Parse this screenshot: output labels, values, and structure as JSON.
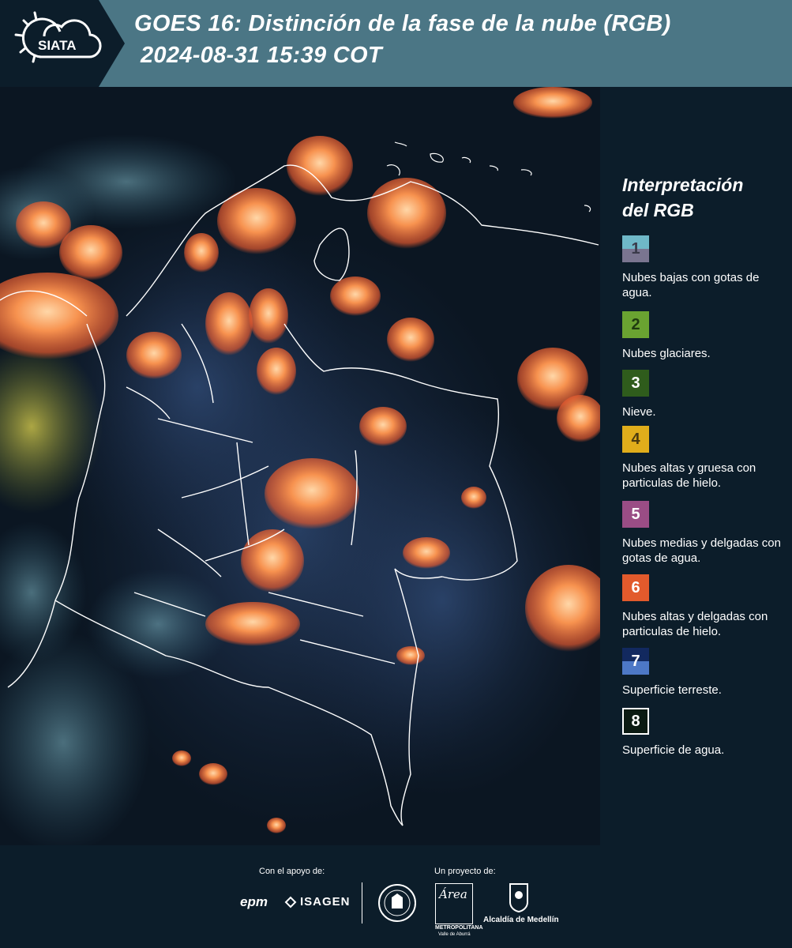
{
  "header": {
    "logo_text": "SIATA",
    "title": "GOES 16: Distinción de la fase de la nube (RGB)",
    "timestamp": "2024-08-31 15:39 COT"
  },
  "legend": {
    "title_line1": "Interpretación",
    "title_line2": "del RGB",
    "items": [
      {
        "number": "1",
        "color_top": "#6fb8c8",
        "color_bottom": "#7a7590",
        "label": "Nubes bajas con gotas de agua.",
        "text_color": "#3a3a4a"
      },
      {
        "number": "2",
        "color": "#6aa331",
        "label": "Nubes glaciares.",
        "text_color": "#1f3a10"
      },
      {
        "number": "3",
        "color": "#2f5c1c",
        "label": "Nieve.",
        "text_color": "#ffffff"
      },
      {
        "number": "4",
        "color": "#e0ad1b",
        "label": "Nubes altas y gruesa con particulas de hielo.",
        "text_color": "#4a3a10"
      },
      {
        "number": "5",
        "color": "#9a4d85",
        "label": "Nubes medias y delgadas con gotas de agua.",
        "text_color": "#ffffff"
      },
      {
        "number": "6",
        "color": "#e25a2c",
        "label": "Nubes altas y delgadas con particulas de hielo.",
        "text_color": "#ffffff"
      },
      {
        "number": "7",
        "color_top": "#12295f",
        "color_bottom": "#4d78c6",
        "label": "Superficie terreste.",
        "text_color": "#ffffff"
      },
      {
        "number": "8",
        "color": "#0b1a12",
        "border": "#ffffff",
        "label": "Superficie de agua.",
        "text_color": "#ffffff"
      }
    ]
  },
  "footer": {
    "support_label": "Con el apoyo de:",
    "project_label": "Un proyecto de:",
    "sponsor_epm": "epm",
    "sponsor_isagen": "ISAGEN",
    "metropolitana_line1": "METROPOLITANA",
    "metropolitana_line2": "Valle de Aburrá",
    "area_script": "Área",
    "alcaldia": "Alcaldía de Medellín"
  },
  "colors": {
    "header_bg": "#4b7685",
    "panel_bg": "#0c1d2a",
    "cloud_orange": "#f3834a",
    "border_white": "#ffffff"
  }
}
